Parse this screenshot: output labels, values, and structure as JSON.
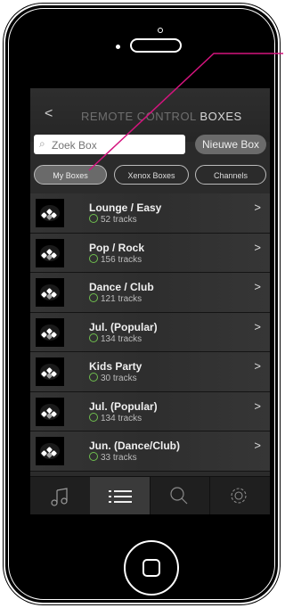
{
  "header": {
    "back": "<",
    "title_dim": "REMOTE CONTROL ",
    "title_bold": "BOXES"
  },
  "search": {
    "placeholder": "Zoek Box",
    "new_label": "Nieuwe Box"
  },
  "tabs": [
    {
      "label": "My Boxes",
      "active": true
    },
    {
      "label": "Xenox Boxes",
      "active": false
    },
    {
      "label": "Channels",
      "active": false
    }
  ],
  "rows": [
    {
      "title": "Lounge / Easy",
      "tracks": "52 tracks"
    },
    {
      "title": "Pop / Rock",
      "tracks": "156 tracks"
    },
    {
      "title": "Dance / Club",
      "tracks": "121 tracks"
    },
    {
      "title": "Jul. (Popular)",
      "tracks": "134 tracks"
    },
    {
      "title": "Kids Party",
      "tracks": "30 tracks"
    },
    {
      "title": "Jul. (Popular)",
      "tracks": "134 tracks"
    },
    {
      "title": "Jun. (Dance/Club)",
      "tracks": "33 tracks"
    }
  ],
  "chevron": ">",
  "tabbar": [
    "music-icon",
    "list-icon",
    "search-icon",
    "settings-gear-icon"
  ],
  "colors": {
    "accent_pointer": "#d4147e",
    "download": "#6fbf4f"
  }
}
